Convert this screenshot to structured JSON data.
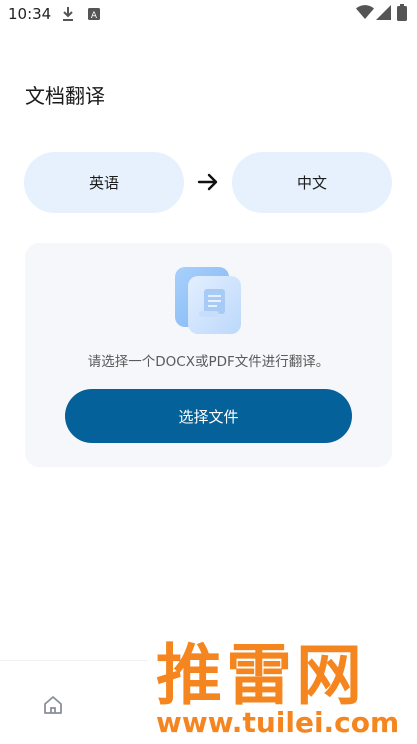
{
  "status_bar": {
    "time": "10:34",
    "left_icons": [
      "download-icon",
      "a-badge-icon"
    ],
    "right_icons": [
      "wifi-icon",
      "signal-icon",
      "battery-icon"
    ]
  },
  "header": {
    "title": "文档翻译"
  },
  "languages": {
    "source": "英语",
    "target": "中文",
    "arrow_icon": "arrow-right-icon"
  },
  "upload": {
    "illustration_icon": "document-stack-icon",
    "hint": "请选择一个DOCX或PDF文件进行翻译。",
    "button_label": "选择文件"
  },
  "bottom_nav": {
    "items": [
      {
        "icon": "home-icon"
      }
    ]
  },
  "watermark": {
    "brand": "推雷网",
    "url": "www.tuilei.com"
  },
  "colors": {
    "accent": "#04619a",
    "pill_bg": "#e6f1fd",
    "card_bg": "#f6f7fa",
    "watermark": "#f5861f"
  }
}
